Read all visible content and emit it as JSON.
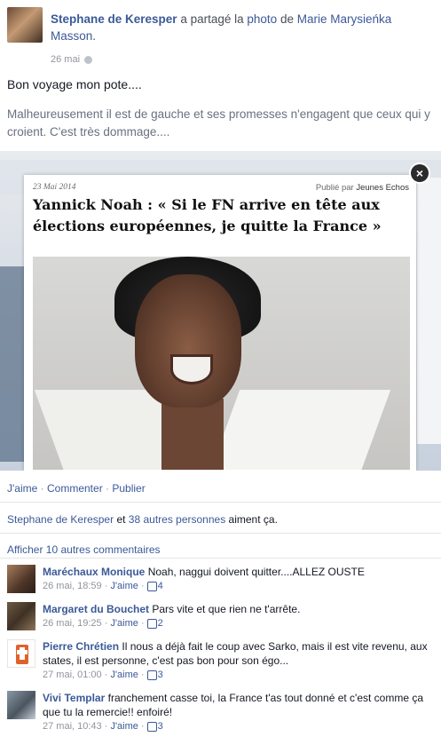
{
  "post": {
    "author": "Stephane de Keresper",
    "shared_text": "a partagé la",
    "photo_link": "photo",
    "of_text": "de",
    "owner": "Marie Marysieńka Masson",
    "date": "26 mai",
    "message": "Bon voyage mon pote....",
    "quote": "Malheureusement il est de gauche et ses promesses n'engagent que ceux qui y croient. C'est très dommage...."
  },
  "article": {
    "date": "23 Mai 2014",
    "published_by_label": "Publié par",
    "publisher": "Jeunes Echos",
    "title": "Yannick Noah : « Si le FN arrive en tête aux élections européennes, je quitte la France »",
    "close_glyph": "×"
  },
  "actions": {
    "like": "J'aime",
    "comment": "Commenter",
    "share": "Publier"
  },
  "likes_summary": {
    "name": "Stephane de Keresper",
    "text": "et",
    "others": "38 autres personnes",
    "suffix": "aiment ça."
  },
  "show_more_comments": "Afficher 10 autres commentaires",
  "comments": [
    {
      "name": "Maréchaux Monique",
      "text": "Noah, naggui doivent quitter....ALLEZ OUSTE",
      "time": "26 mai, 18:59",
      "like": "J'aime",
      "likes": "4"
    },
    {
      "name": "Margaret du Bouchet",
      "text": "Pars vite et que rien ne t'arrête.",
      "time": "26 mai, 19:25",
      "like": "J'aime",
      "likes": "2"
    },
    {
      "name": "Pierre Chrétien",
      "text": "Il nous a déjà fait le coup avec Sarko, mais il est vite revenu, aux states, il est personne, c'est pas bon pour son égo...",
      "time": "27 mai, 01:00",
      "like": "J'aime",
      "likes": "3"
    },
    {
      "name": "Vivi Templar",
      "text": "franchement casse toi, la France t'as tout donné et c'est comme ça que tu la remercie!! enfoiré!",
      "time": "27 mai, 10:43",
      "like": "J'aime",
      "likes": "3"
    }
  ],
  "colors": {
    "link": "#3b5998",
    "meta": "#90949c"
  }
}
